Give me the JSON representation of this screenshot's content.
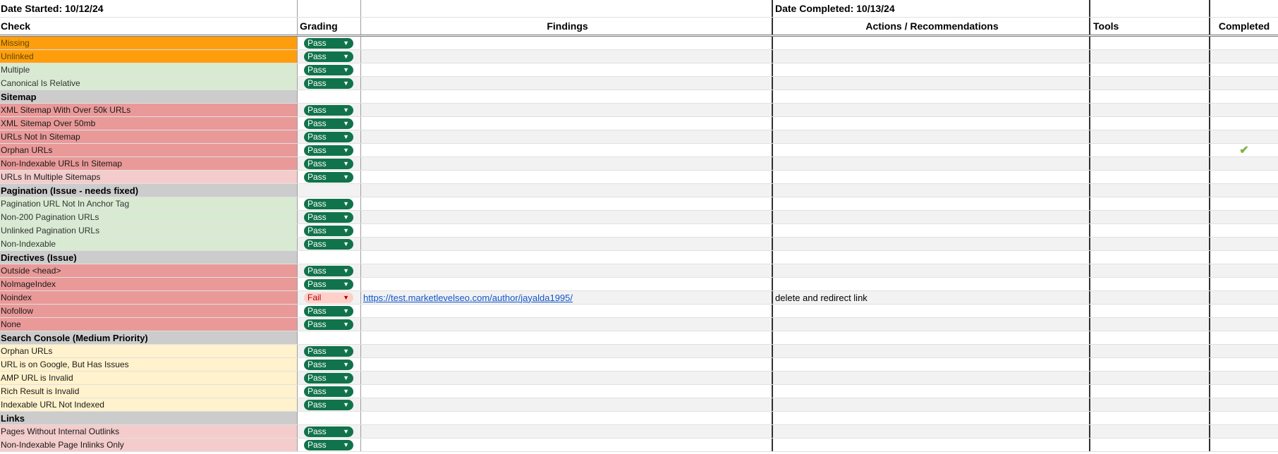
{
  "header": {
    "date_started": "Date Started: 10/12/24",
    "date_completed": "Date Completed: 10/13/24",
    "columns": {
      "check": "Check",
      "grading": "Grading",
      "findings": "Findings",
      "actions": "Actions / Recommendations",
      "tools": "Tools",
      "completed": "Completed"
    }
  },
  "colors": {
    "orange": "#ff9e0d",
    "green": "#d9ead3",
    "red": "#ea9999",
    "pink": "#f4cccc",
    "yellow": "#fff2cc",
    "section": "#cccccc",
    "pass_chip": "#11734b",
    "fail_chip": "#ffcfc9"
  },
  "rows": [
    {
      "label": "Missing",
      "color": "orange",
      "grade": "Pass"
    },
    {
      "label": "Unlinked",
      "color": "orange",
      "grade": "Pass"
    },
    {
      "label": "Multiple",
      "color": "green",
      "grade": "Pass"
    },
    {
      "label": "Canonical Is Relative",
      "color": "green",
      "grade": "Pass"
    },
    {
      "label": "Sitemap",
      "section": true
    },
    {
      "label": "XML Sitemap With Over 50k URLs",
      "color": "red",
      "grade": "Pass"
    },
    {
      "label": "XML Sitemap Over 50mb",
      "color": "red",
      "grade": "Pass"
    },
    {
      "label": "URLs Not In Sitemap",
      "color": "red",
      "grade": "Pass"
    },
    {
      "label": "Orphan URLs",
      "color": "red",
      "grade": "Pass",
      "completed": "checkmark-icon"
    },
    {
      "label": "Non-Indexable URLs In Sitemap",
      "color": "red",
      "grade": "Pass"
    },
    {
      "label": "URLs In Multiple Sitemaps",
      "color": "pink",
      "grade": "Pass"
    },
    {
      "label": "Pagination (Issue - needs fixed)",
      "section": true
    },
    {
      "label": "Pagination URL Not In Anchor Tag",
      "color": "green",
      "grade": "Pass"
    },
    {
      "label": "Non-200 Pagination URLs",
      "color": "green",
      "grade": "Pass"
    },
    {
      "label": "Unlinked Pagination URLs",
      "color": "green",
      "grade": "Pass"
    },
    {
      "label": "Non-Indexable",
      "color": "green",
      "grade": "Pass"
    },
    {
      "label": "Directives (Issue)",
      "section": true
    },
    {
      "label": "Outside <head>",
      "color": "red",
      "grade": "Pass"
    },
    {
      "label": "NoImageIndex",
      "color": "red",
      "grade": "Pass"
    },
    {
      "label": "Noindex",
      "color": "red",
      "grade": "Fail",
      "finding": "https://test.marketlevelseo.com/author/jayalda1995/",
      "action": "delete and redirect link"
    },
    {
      "label": "Nofollow",
      "color": "red",
      "grade": "Pass"
    },
    {
      "label": "None",
      "color": "red",
      "grade": "Pass"
    },
    {
      "label": "Search Console (Medium Priority)",
      "section": true
    },
    {
      "label": "Orphan URLs",
      "color": "yellow",
      "grade": "Pass"
    },
    {
      "label": "URL is on Google, But Has Issues",
      "color": "yellow",
      "grade": "Pass"
    },
    {
      "label": "AMP URL is Invalid",
      "color": "yellow",
      "grade": "Pass"
    },
    {
      "label": "Rich Result is Invalid",
      "color": "yellow",
      "grade": "Pass"
    },
    {
      "label": "Indexable URL Not Indexed",
      "color": "yellow",
      "grade": "Pass"
    },
    {
      "label": "Links",
      "section": true
    },
    {
      "label": "Pages Without Internal Outlinks",
      "color": "pink",
      "grade": "Pass"
    },
    {
      "label": "Non-Indexable Page Inlinks Only",
      "color": "pink",
      "grade": "Pass"
    }
  ]
}
